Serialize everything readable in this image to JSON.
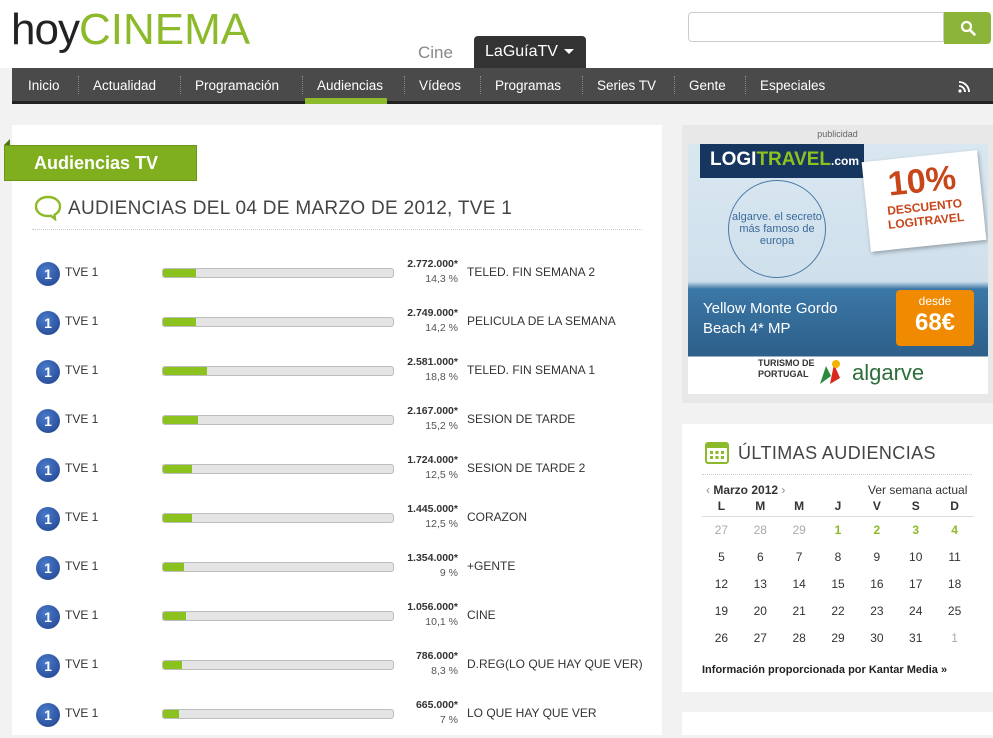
{
  "logo": {
    "hoy": "hoy",
    "cinema": "CINEMA"
  },
  "search": {
    "placeholder": ""
  },
  "top_tabs": {
    "cine": "Cine",
    "guia": "LaGuíaTV"
  },
  "nav": [
    "Inicio",
    "Actualidad",
    "Programación",
    "Audiencias",
    "Vídeos",
    "Programas",
    "Series TV",
    "Gente",
    "Especiales"
  ],
  "nav_active": "Audiencias",
  "section_label": "Audiencias TV",
  "page_title": "AUDIENCIAS DEL 04 DE MARZO DE 2012, TVE 1",
  "rows": [
    {
      "channel": "TVE 1",
      "viewers": "2.772.000*",
      "share": "14,3 %",
      "share_value": 14.3,
      "program": "TELED. FIN SEMANA 2"
    },
    {
      "channel": "TVE 1",
      "viewers": "2.749.000*",
      "share": "14,2 %",
      "share_value": 14.2,
      "program": "PELICULA DE LA SEMANA"
    },
    {
      "channel": "TVE 1",
      "viewers": "2.581.000*",
      "share": "18,8 %",
      "share_value": 18.8,
      "program": "TELED. FIN SEMANA 1"
    },
    {
      "channel": "TVE 1",
      "viewers": "2.167.000*",
      "share": "15,2 %",
      "share_value": 15.2,
      "program": "SESION DE TARDE"
    },
    {
      "channel": "TVE 1",
      "viewers": "1.724.000*",
      "share": "12,5 %",
      "share_value": 12.5,
      "program": "SESION DE TARDE 2"
    },
    {
      "channel": "TVE 1",
      "viewers": "1.445.000*",
      "share": "12,5 %",
      "share_value": 12.5,
      "program": "CORAZON"
    },
    {
      "channel": "TVE 1",
      "viewers": "1.354.000*",
      "share": "9 %",
      "share_value": 9,
      "program": "+GENTE"
    },
    {
      "channel": "TVE 1",
      "viewers": "1.056.000*",
      "share": "10,1 %",
      "share_value": 10.1,
      "program": "CINE"
    },
    {
      "channel": "TVE 1",
      "viewers": "786.000*",
      "share": "8,3 %",
      "share_value": 8.3,
      "program": "D.REG(LO QUE HAY QUE VER)"
    },
    {
      "channel": "TVE 1",
      "viewers": "665.000*",
      "share": "7 %",
      "share_value": 7,
      "program": "LO QUE HAY QUE VER"
    }
  ],
  "ad": {
    "label": "publicidad",
    "brand_a": "LOGI",
    "brand_b": "TRAVEL",
    "brand_c": ".com",
    "circle_text": "algarve. el secreto más famoso de europa",
    "promo_pct": "10%",
    "promo_line1": "DESCUENTO",
    "promo_line2": "LOGITRAVEL",
    "hotel_line1": "Yellow Monte Gordo",
    "hotel_line2": "Beach 4* MP",
    "price_desde": "desde",
    "price_amount": "68€",
    "foot_line1": "TURISMO DE",
    "foot_line2": "PORTUGAL",
    "algarve": "algarve"
  },
  "calendar": {
    "title": "ÚLTIMAS AUDIENCIAS",
    "month": "Marzo 2012",
    "week_link": "Ver semana actual",
    "days": [
      "L",
      "M",
      "M",
      "J",
      "V",
      "S",
      "D"
    ],
    "weeks": [
      [
        {
          "d": "27",
          "s": "muted"
        },
        {
          "d": "28",
          "s": "muted"
        },
        {
          "d": "29",
          "s": "muted"
        },
        {
          "d": "1",
          "s": "green"
        },
        {
          "d": "2",
          "s": "green"
        },
        {
          "d": "3",
          "s": "green"
        },
        {
          "d": "4",
          "s": "green"
        }
      ],
      [
        {
          "d": "5",
          "s": ""
        },
        {
          "d": "6",
          "s": ""
        },
        {
          "d": "7",
          "s": ""
        },
        {
          "d": "8",
          "s": ""
        },
        {
          "d": "9",
          "s": ""
        },
        {
          "d": "10",
          "s": ""
        },
        {
          "d": "11",
          "s": ""
        }
      ],
      [
        {
          "d": "12",
          "s": ""
        },
        {
          "d": "13",
          "s": ""
        },
        {
          "d": "14",
          "s": ""
        },
        {
          "d": "15",
          "s": ""
        },
        {
          "d": "16",
          "s": ""
        },
        {
          "d": "17",
          "s": ""
        },
        {
          "d": "18",
          "s": ""
        }
      ],
      [
        {
          "d": "19",
          "s": ""
        },
        {
          "d": "20",
          "s": ""
        },
        {
          "d": "21",
          "s": ""
        },
        {
          "d": "22",
          "s": ""
        },
        {
          "d": "23",
          "s": ""
        },
        {
          "d": "24",
          "s": ""
        },
        {
          "d": "25",
          "s": ""
        }
      ],
      [
        {
          "d": "26",
          "s": ""
        },
        {
          "d": "27",
          "s": ""
        },
        {
          "d": "28",
          "s": ""
        },
        {
          "d": "29",
          "s": ""
        },
        {
          "d": "30",
          "s": ""
        },
        {
          "d": "31",
          "s": ""
        },
        {
          "d": "1",
          "s": "muted"
        }
      ]
    ],
    "footer": "Información proporcionada por Kantar Media »"
  },
  "colors": {
    "accent": "#8cba2a",
    "nav_bg": "#4a4a4a",
    "bar_fill": "#8cc21e"
  }
}
